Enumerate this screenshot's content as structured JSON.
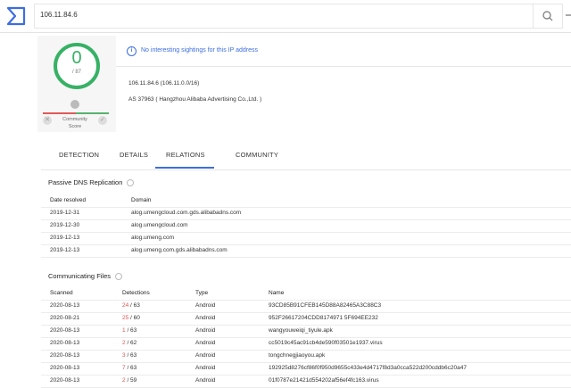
{
  "search": {
    "query": "106.11.84.6"
  },
  "score": {
    "detections": "0",
    "total": "/ 87"
  },
  "community": {
    "label_line1": "Community",
    "label_line2": "Score",
    "dislike": "✕",
    "like": "✓"
  },
  "banner": {
    "text": "No interesting sightings for this IP address"
  },
  "ip": {
    "line": "106.11.84.6   (106.11.0.0/16)",
    "as_line": "AS 37963 ( Hangzhou Alibaba Advertising Co.,Ltd. )"
  },
  "tabs": [
    "DETECTION",
    "DETAILS",
    "RELATIONS",
    "COMMUNITY"
  ],
  "passive_dns": {
    "title": "Passive DNS Replication",
    "headers": [
      "Date resolved",
      "Domain"
    ],
    "rows": [
      [
        "2019-12-31",
        "alog.umengcloud.com.gds.alibabadns.com"
      ],
      [
        "2019-12-30",
        "alog.umengcloud.com"
      ],
      [
        "2019-12-13",
        "alog.umeng.com"
      ],
      [
        "2019-12-13",
        "alog.umeng.com.gds.alibabadns.com"
      ]
    ]
  },
  "files": {
    "title": "Communicating Files",
    "headers": [
      "Scanned",
      "Detections",
      "Type",
      "Name"
    ],
    "rows": [
      [
        "2020-08-13",
        "24",
        "/ 63",
        "Android",
        "93CD85B91CFEB145D88A82465A3C88C3"
      ],
      [
        "2020-08-21",
        "25",
        "/ 60",
        "Android",
        "952F26617204CDD8174971 5F694EE232"
      ],
      [
        "2020-08-13",
        "1",
        "/ 63",
        "Android",
        "wangyouweiqi_tiyule.apk"
      ],
      [
        "2020-08-13",
        "2",
        "/ 62",
        "Android",
        "cc5019c45ac91cb4de590f03501e1937.virus"
      ],
      [
        "2020-08-13",
        "3",
        "/ 63",
        "Android",
        "tongchnegjiaoyou.apk"
      ],
      [
        "2020-08-13",
        "7",
        "/ 63",
        "Android",
        "192925d8276cf86f0f950d9655c433e4d4717f8d3a0cca522d200cddb6c20a47"
      ],
      [
        "2020-08-13",
        "2",
        "/ 59",
        "Android",
        "01f0787e21421d554202af56ef4fc163.virus"
      ]
    ]
  },
  "colors": {
    "accent": "#3d6de0",
    "clean": "#37b165",
    "malicious": "#e05252"
  }
}
